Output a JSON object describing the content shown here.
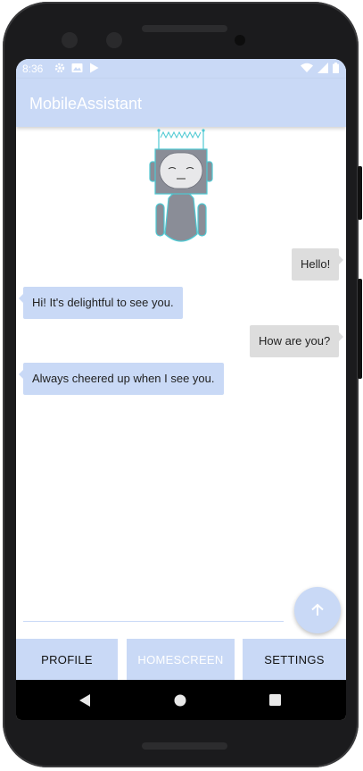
{
  "status_bar": {
    "time": "8:36",
    "left_icons": [
      "gear-icon",
      "image-icon",
      "play-store-icon"
    ],
    "right_icons": [
      "wifi-icon",
      "signal-icon",
      "battery-icon"
    ]
  },
  "app_bar": {
    "title": "MobileAssistant"
  },
  "messages": [
    {
      "sender": "user",
      "text": "Hello!"
    },
    {
      "sender": "bot",
      "text": "Hi! It's delightful to see you."
    },
    {
      "sender": "user",
      "text": "How are you?"
    },
    {
      "sender": "bot",
      "text": "Always cheered up when I see you."
    }
  ],
  "input": {
    "value": "",
    "placeholder": ""
  },
  "send_button": {
    "icon": "arrow-up-icon"
  },
  "bottom_nav": {
    "profile_label": "PROFILE",
    "homescreen_label": "HOMESCREEN",
    "settings_label": "SETTINGS"
  },
  "system_nav": {
    "icons": [
      "back-icon",
      "home-icon",
      "recents-icon"
    ]
  },
  "colors": {
    "accent": "#c9d9f6",
    "user_bubble": "#dddddd",
    "robot_body": "#8a8d97",
    "robot_outline": "#4ec9d3"
  }
}
